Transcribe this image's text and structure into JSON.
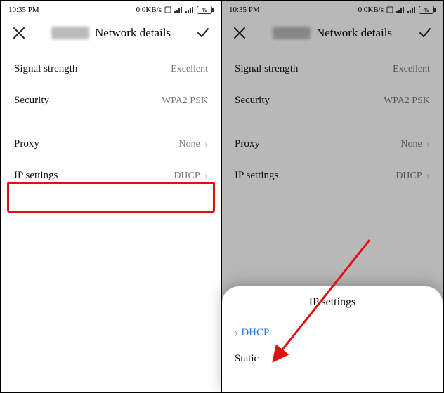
{
  "status": {
    "time": "10:35 PM",
    "net_rate": "0.0KB/s",
    "battery": "49"
  },
  "header": {
    "title": "Network details"
  },
  "rows": {
    "signal_label": "Signal strength",
    "signal_value": "Excellent",
    "security_label": "Security",
    "security_value": "WPA2 PSK",
    "proxy_label": "Proxy",
    "proxy_value": "None",
    "ip_label": "IP settings",
    "ip_value": "DHCP"
  },
  "sheet": {
    "title": "IP settings",
    "option_dhcp": "DHCP",
    "option_static": "Static"
  }
}
